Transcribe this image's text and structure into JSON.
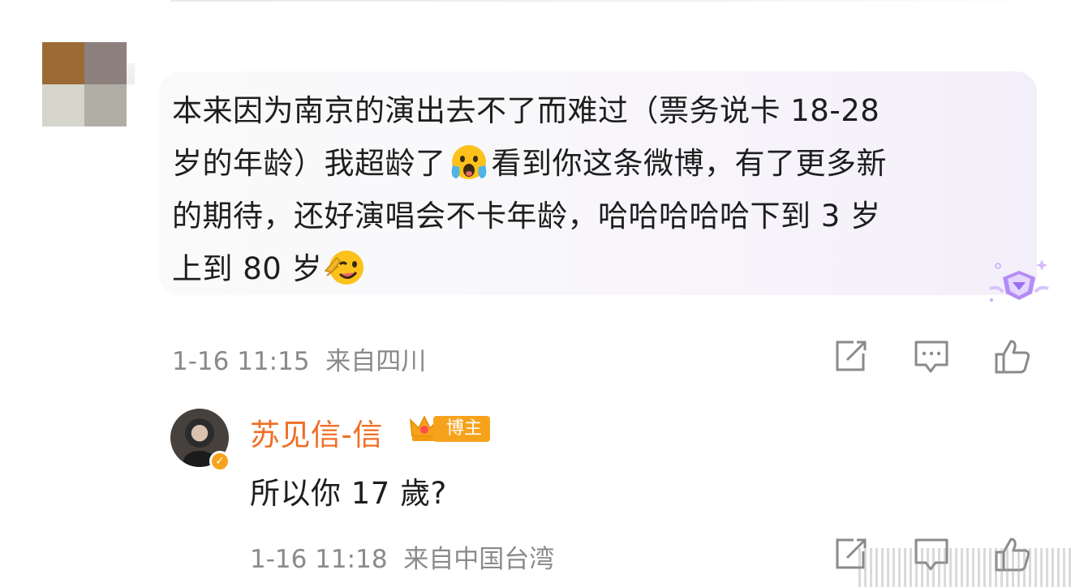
{
  "comment": {
    "text_line1": "本来因为南京的演出去不了而难过（票务说卡 18-28",
    "text_line2_a": "岁的年龄）我超龄了",
    "text_line2_b": "看到你这条微博，有了更多新",
    "text_line3": "的期待，还好演唱会不卡年龄，哈哈哈哈哈下到 3 岁",
    "text_line4": "上到 80 岁",
    "emoji_1": "crying-face-icon",
    "emoji_2": "wink-hand-face-icon",
    "timestamp": "1-16 11:15",
    "location": "来自四川"
  },
  "reply": {
    "author": "苏见信-信",
    "badge_label": "博主",
    "text": "所以你 17 歲?",
    "timestamp": "1-16 11:18",
    "location": "来自中国台湾"
  },
  "colors": {
    "author": "#f06d23",
    "badge": "#f7a21b",
    "meta": "#8a8a8a",
    "bubble": "#f7f5fa"
  },
  "icons": [
    "share-icon",
    "comment-icon",
    "like-icon",
    "diamond-member-icon",
    "verified-icon",
    "crown-icon"
  ]
}
